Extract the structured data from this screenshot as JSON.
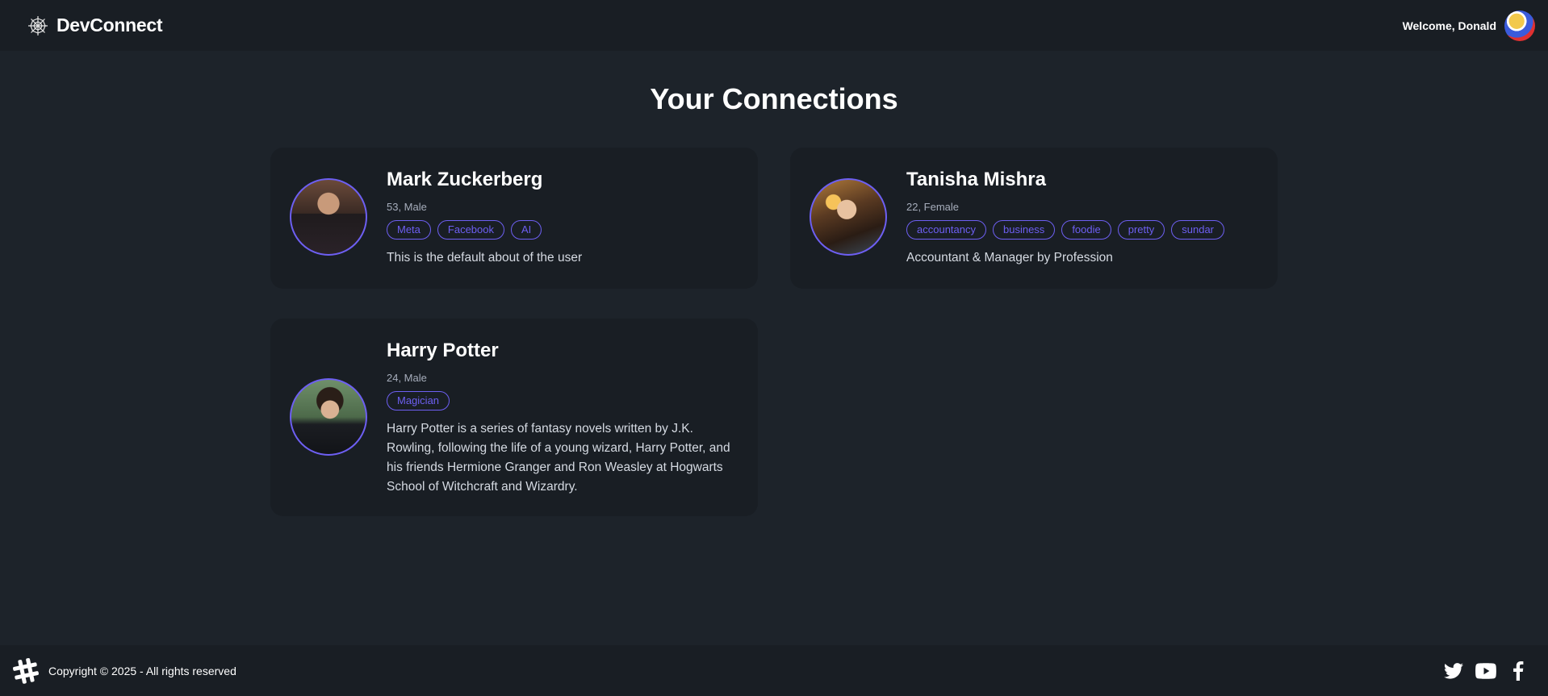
{
  "navbar": {
    "brand": "DevConnect",
    "brand_icon": "spider-web-icon",
    "welcome": "Welcome, Donald"
  },
  "page": {
    "title": "Your Connections"
  },
  "connections": [
    {
      "name": "Mark Zuckerberg",
      "meta": "53, Male",
      "skills": [
        "Meta",
        "Facebook",
        "AI"
      ],
      "about": "This is the default about of the user"
    },
    {
      "name": "Tanisha Mishra",
      "meta": "22, Female",
      "skills": [
        "accountancy",
        "business",
        "foodie",
        "pretty",
        "sundar"
      ],
      "about": "Accountant & Manager by Profession"
    },
    {
      "name": "Harry Potter",
      "meta": "24, Male",
      "skills": [
        "Magician"
      ],
      "about": "Harry Potter is a series of fantasy novels written by J.K. Rowling, following the life of a young wizard, Harry Potter, and his friends Hermione Granger and Ron Weasley at Hogwarts School of Witchcraft and Wizardry."
    }
  ],
  "footer": {
    "copyright": "Copyright © 2025 - All rights reserved",
    "logo_icon": "hashtag-logo-icon",
    "social_icons": [
      "twitter-icon",
      "youtube-icon",
      "facebook-icon"
    ]
  },
  "colors": {
    "background": "#1d232a",
    "navbar": "#191e24",
    "card": "#191e24",
    "accent": "#6d5ff2"
  }
}
